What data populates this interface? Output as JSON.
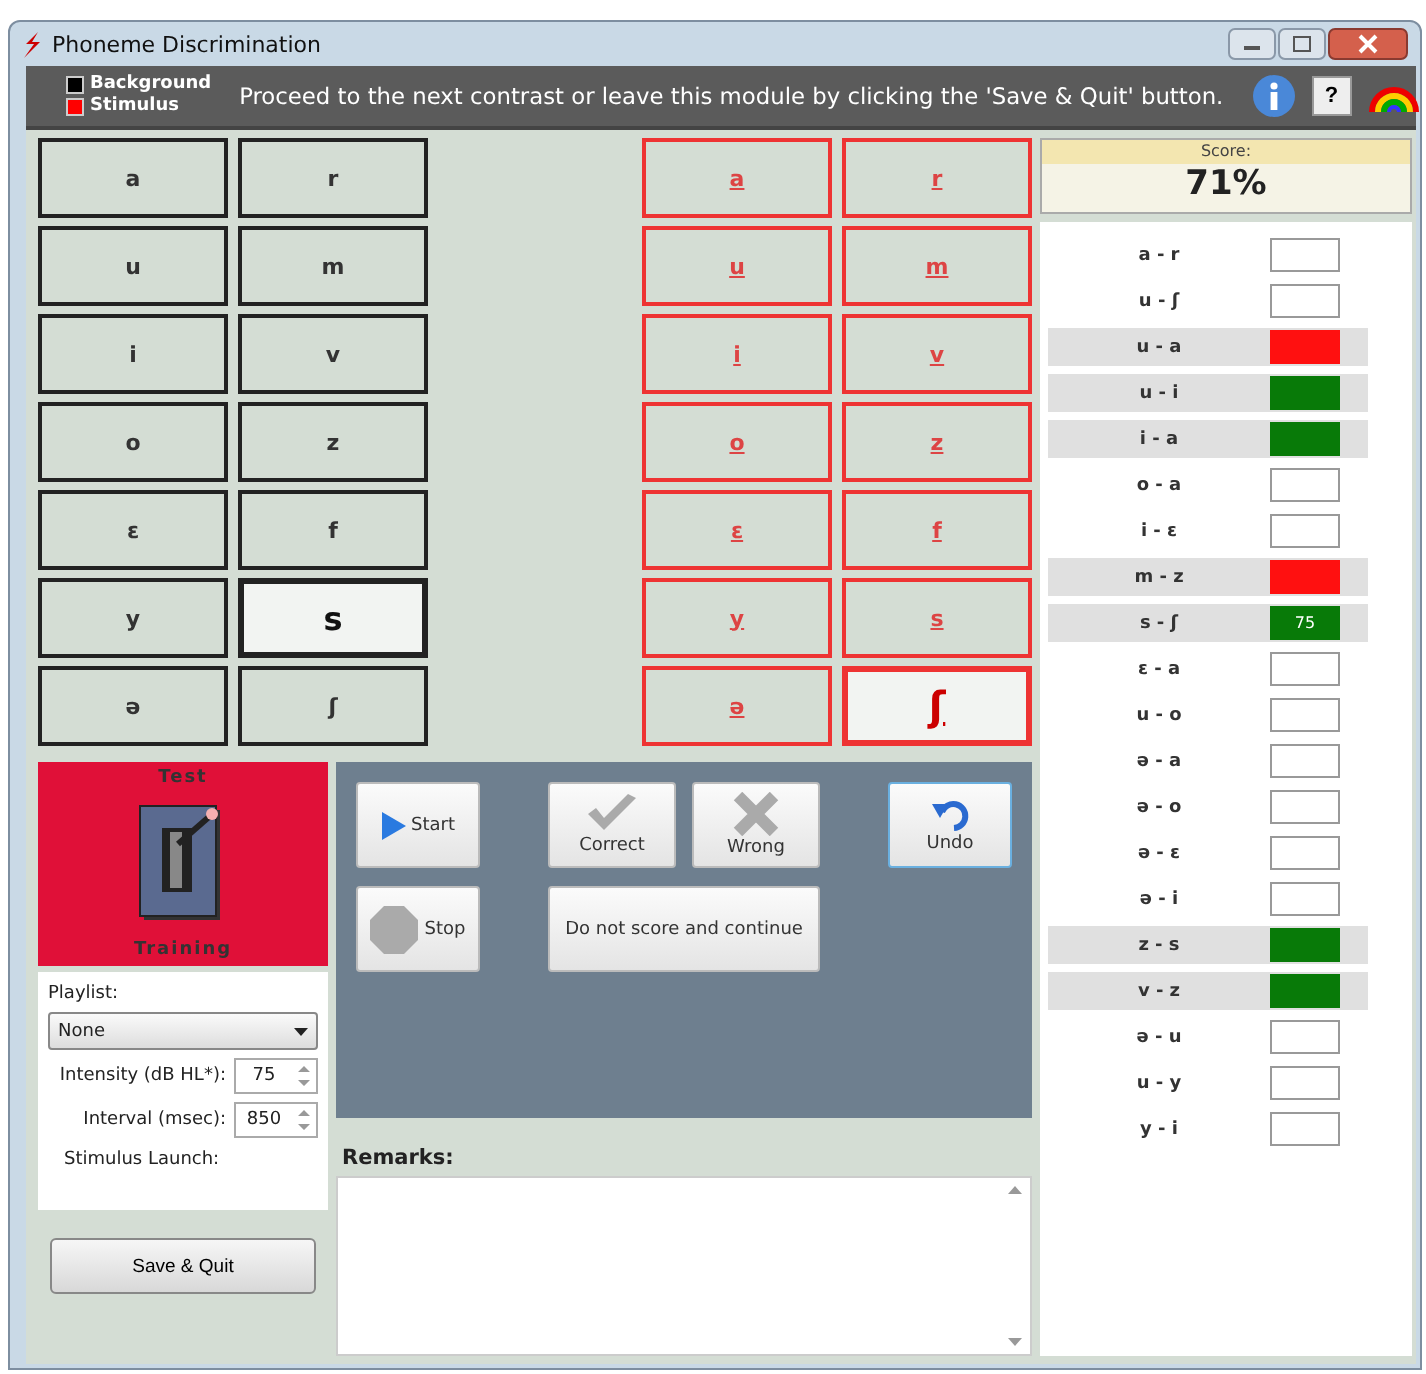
{
  "window": {
    "title": "Phoneme Discrimination"
  },
  "header": {
    "legend": [
      {
        "label": "Background",
        "color": "#000000"
      },
      {
        "label": "Stimulus",
        "color": "#ff0000"
      }
    ],
    "message": "Proceed to the next contrast or leave this module by clicking the 'Save & Quit' button.",
    "help_button": "?"
  },
  "background_buttons": [
    {
      "label": "a",
      "selected": false
    },
    {
      "label": "r",
      "selected": false
    },
    {
      "label": "u",
      "selected": false
    },
    {
      "label": "m",
      "selected": false
    },
    {
      "label": "i",
      "selected": false
    },
    {
      "label": "v",
      "selected": false
    },
    {
      "label": "o",
      "selected": false
    },
    {
      "label": "z",
      "selected": false
    },
    {
      "label": "ɛ",
      "selected": false
    },
    {
      "label": "f",
      "selected": false
    },
    {
      "label": "y",
      "selected": false
    },
    {
      "label": "s",
      "selected": true
    },
    {
      "label": "ə",
      "selected": false
    },
    {
      "label": "ʃ",
      "selected": false
    }
  ],
  "stimulus_buttons": [
    {
      "label": "a",
      "selected": false
    },
    {
      "label": "r",
      "selected": false
    },
    {
      "label": "u",
      "selected": false
    },
    {
      "label": "m",
      "selected": false
    },
    {
      "label": "i",
      "selected": false
    },
    {
      "label": "v",
      "selected": false
    },
    {
      "label": "o",
      "selected": false
    },
    {
      "label": "z",
      "selected": false
    },
    {
      "label": "ɛ",
      "selected": false
    },
    {
      "label": "f",
      "selected": false
    },
    {
      "label": "y",
      "selected": false
    },
    {
      "label": "s",
      "selected": false
    },
    {
      "label": "ə",
      "selected": false
    },
    {
      "label": "ʃ",
      "selected": true
    }
  ],
  "mode": {
    "top_label": "Test",
    "bottom_label": "Training"
  },
  "settings": {
    "playlist_label": "Playlist:",
    "playlist_value": "None",
    "intensity_label": "Intensity (dB HL*):",
    "intensity_value": "75",
    "interval_label": "Interval (msec):",
    "interval_value": "850",
    "launch_label": "Stimulus Launch:"
  },
  "save_button": "Save & Quit",
  "controls": {
    "start": "Start",
    "stop": "Stop",
    "correct": "Correct",
    "wrong": "Wrong",
    "undo": "Undo",
    "skip": "Do not score and continue"
  },
  "remarks": {
    "label": "Remarks:"
  },
  "score": {
    "label": "Score:",
    "value": "71%"
  },
  "contrasts": [
    {
      "pair": "a - r"
    },
    {
      "pair": "u - ʃ"
    },
    {
      "pair": "u - a",
      "color": "#ff1010"
    },
    {
      "pair": "u - i",
      "color": "#087a08"
    },
    {
      "pair": "i - a",
      "color": "#087a08"
    },
    {
      "pair": "o - a"
    },
    {
      "pair": "i - ɛ"
    },
    {
      "pair": "m - z",
      "color": "#ff1010"
    },
    {
      "pair": "s - ʃ",
      "color": "#087a08",
      "value": "75"
    },
    {
      "pair": "ɛ - a"
    },
    {
      "pair": "u - o"
    },
    {
      "pair": "ə - a"
    },
    {
      "pair": "ə - o"
    },
    {
      "pair": "ə - ɛ"
    },
    {
      "pair": "ə - i"
    },
    {
      "pair": "z - s",
      "color": "#087a08"
    },
    {
      "pair": "v - z",
      "color": "#087a08"
    },
    {
      "pair": "ə - u"
    },
    {
      "pair": "u - y"
    },
    {
      "pair": "y - i"
    }
  ]
}
